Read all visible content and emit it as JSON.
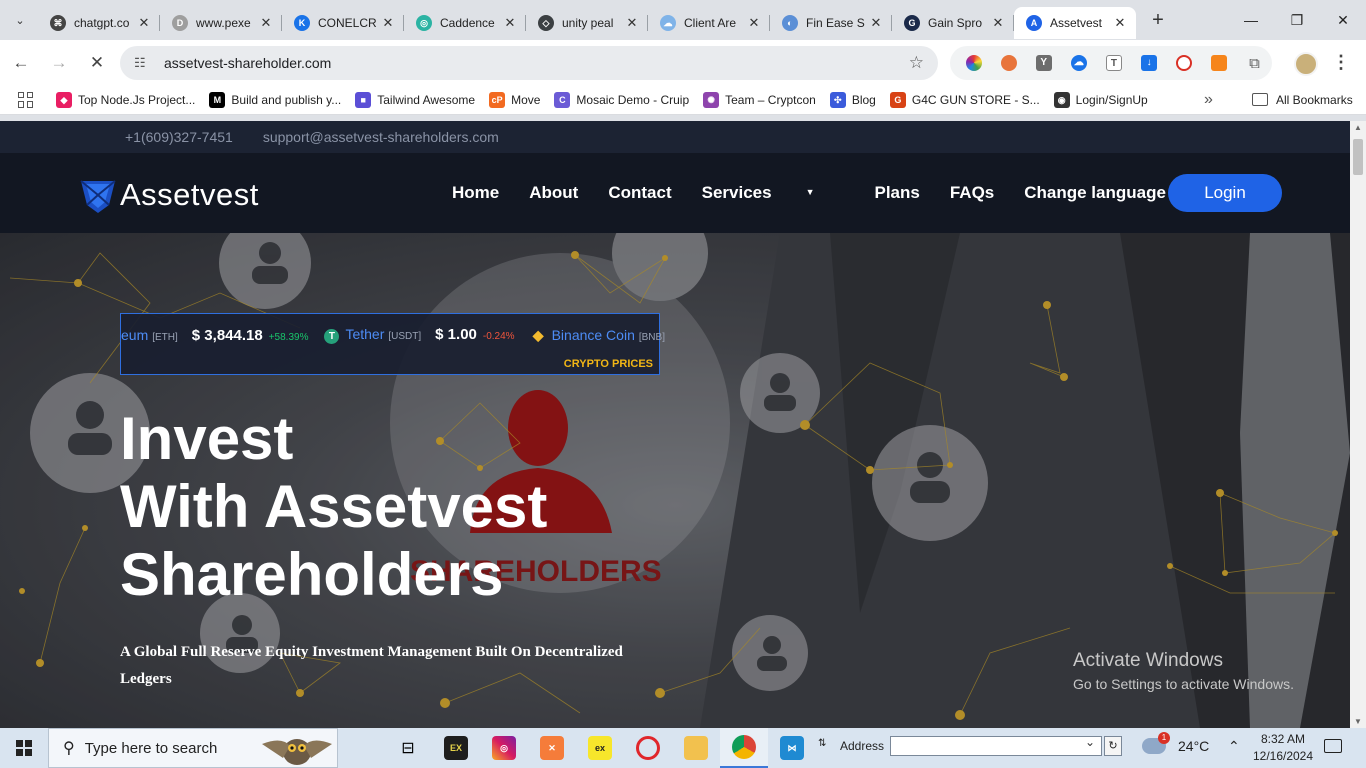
{
  "browser": {
    "tabs": [
      {
        "title": "chatgpt.co",
        "color": "#444444",
        "glyph": "⌘"
      },
      {
        "title": "www.pexe",
        "color": "#9e9e9e",
        "glyph": "D"
      },
      {
        "title": "CONELCR",
        "color": "#1a73e8",
        "glyph": "K"
      },
      {
        "title": "Caddence",
        "color": "#2bb3a3",
        "glyph": "◎"
      },
      {
        "title": "unity peal",
        "color": "#3c4043",
        "glyph": "◇"
      },
      {
        "title": "Client Are",
        "color": "#7fb3e8",
        "glyph": "☁"
      },
      {
        "title": "Fin Ease S",
        "color": "#5b8fd6",
        "glyph": "◐"
      },
      {
        "title": "Gain Spro",
        "color": "#1b2a4a",
        "glyph": "G"
      },
      {
        "title": "Assetvest",
        "color": "#1f63e6",
        "glyph": "A"
      }
    ],
    "tab_close": "✕",
    "new_tab": "+",
    "window_controls": {
      "minimize": "—",
      "maximize": "❐",
      "close": "✕"
    },
    "nav": {
      "back": "←",
      "forward": "→",
      "reload": "✕"
    },
    "url": "assetvest-shareholder.com",
    "bookmarks": [
      {
        "label": "Top Node.Js Project...",
        "color": "#e91e63",
        "glyph": "◆"
      },
      {
        "label": "Build and publish y...",
        "color": "#000000",
        "glyph": "M"
      },
      {
        "label": "Tailwind Awesome",
        "color": "#5b4fd6",
        "glyph": "■"
      },
      {
        "label": "Move",
        "color": "#f26a21",
        "glyph": "cP"
      },
      {
        "label": "Mosaic Demo - Cruip",
        "color": "#6b5bd6",
        "glyph": "C"
      },
      {
        "label": "Team – Cryptcon",
        "color": "#8e44ad",
        "glyph": "✺"
      },
      {
        "label": "Blog",
        "color": "#3b5bdb",
        "glyph": "✣"
      },
      {
        "label": "G4C GUN STORE - S...",
        "color": "#d84315",
        "glyph": "G"
      },
      {
        "label": "Login/SignUp",
        "color": "#333333",
        "glyph": "◉"
      }
    ],
    "bookmarks_more": "»",
    "all_bookmarks": "All Bookmarks"
  },
  "site": {
    "phone": "+1(609)327-7451",
    "email": "support@assetvest-shareholders.com",
    "logo_text": "Assetvest",
    "nav": [
      "Home",
      "About",
      "Contact",
      "Services",
      "Plans",
      "FAQs",
      "Change language"
    ],
    "services_caret": "▼",
    "login": "Login",
    "ticker": [
      {
        "name": "eum",
        "symbol": "[ETH]",
        "price": "$ 3,844.18",
        "change": "+58.39%",
        "direction": "up",
        "icon": "",
        "icon_color": ""
      },
      {
        "name": "Tether",
        "symbol": "[USDT]",
        "price": "$ 1.00",
        "change": "-0.24%",
        "direction": "down",
        "icon": "T",
        "icon_color": "#26a17b"
      },
      {
        "name": "Binance Coin",
        "symbol": "[BNB]",
        "price": "",
        "change": "",
        "direction": "",
        "icon": "◆",
        "icon_color": "#f3ba2f"
      }
    ],
    "ticker_label": "CRYPTO PRICES",
    "headline": "Invest\nWith Assetvest\nShareholders",
    "background_text": "SHAREHOLDERS",
    "subheadline": "A Global Full Reserve Equity Investment Management Built On Decentralized Ledgers",
    "watermark_title": "Activate Windows",
    "watermark_sub": "Go to Settings to activate Windows."
  },
  "taskbar": {
    "search_placeholder": "Type here to search",
    "address_label": "Address",
    "weather": "24°C",
    "weather_badge": "1",
    "time": "8:32 AM",
    "date": "12/16/2024"
  }
}
